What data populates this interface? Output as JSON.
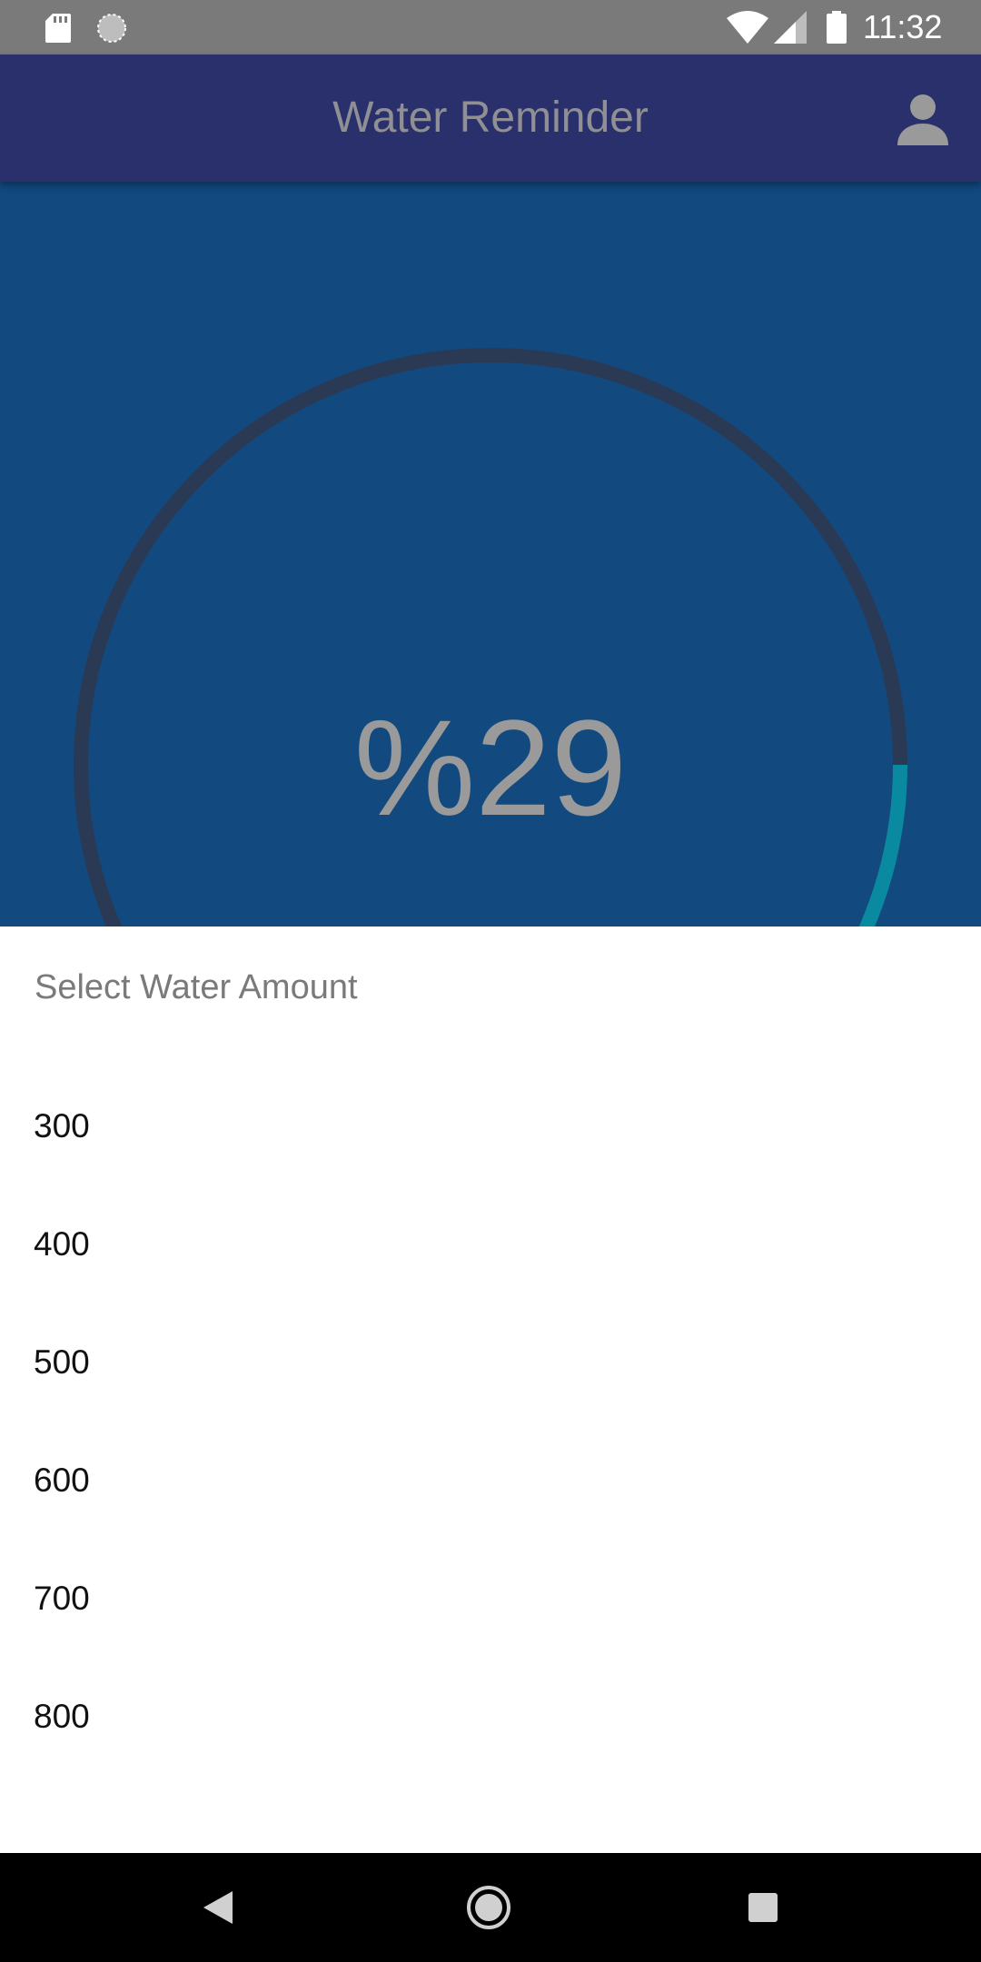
{
  "status_bar": {
    "time": "11:32",
    "icons": [
      "sd-card-icon",
      "sync-icon",
      "wifi-icon",
      "cell-signal-icon",
      "battery-icon"
    ]
  },
  "app_bar": {
    "title": "Water Reminder",
    "profile_icon": "person-icon"
  },
  "progress": {
    "label": "%29",
    "value_fraction": 0.29,
    "track_color": "#2a3a55",
    "fill_color": "#0a8aa0"
  },
  "sheet": {
    "title": "Select Water Amount",
    "options": [
      "300",
      "400",
      "500",
      "600",
      "700",
      "800"
    ]
  },
  "nav_bar": {
    "buttons": [
      "back-icon",
      "home-icon",
      "recents-icon"
    ]
  },
  "colors": {
    "app_bar": "#29306b",
    "progress_bg": "#12497f",
    "sheet_bg": "#ffffff"
  }
}
